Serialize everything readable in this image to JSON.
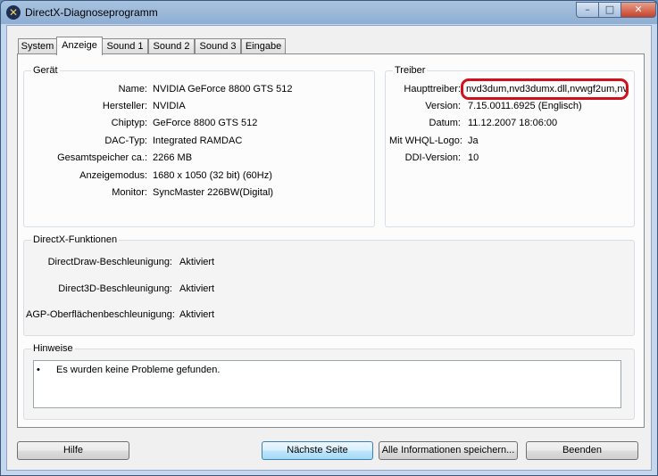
{
  "window": {
    "title": "DirectX-Diagnoseprogramm",
    "icon": "directx-icon"
  },
  "tabs": [
    {
      "label": "System",
      "active": false
    },
    {
      "label": "Anzeige",
      "active": true
    },
    {
      "label": "Sound 1",
      "active": false
    },
    {
      "label": "Sound 2",
      "active": false
    },
    {
      "label": "Sound 3",
      "active": false
    },
    {
      "label": "Eingabe",
      "active": false
    }
  ],
  "device": {
    "title": "Gerät",
    "rows": [
      {
        "label": "Name:",
        "value": "NVIDIA GeForce 8800 GTS 512"
      },
      {
        "label": "Hersteller:",
        "value": "NVIDIA"
      },
      {
        "label": "Chiptyp:",
        "value": "GeForce 8800 GTS 512"
      },
      {
        "label": "DAC-Typ:",
        "value": "Integrated RAMDAC"
      },
      {
        "label": "Gesamtspeicher ca.:",
        "value": "2266 MB"
      },
      {
        "label": "Anzeigemodus:",
        "value": "1680 x 1050 (32 bit) (60Hz)"
      },
      {
        "label": "Monitor:",
        "value": "SyncMaster 226BW(Digital)"
      }
    ]
  },
  "driver": {
    "title": "Treiber",
    "rows": [
      {
        "label": "Haupttreiber:",
        "value": "nvd3dum,nvd3dumx.dll,nvwgf2um,nv"
      },
      {
        "label": "Version:",
        "value": "7.15.0011.6925 (Englisch)"
      },
      {
        "label": "Datum:",
        "value": "11.12.2007 18:06:00"
      },
      {
        "label": "Mit WHQL-Logo:",
        "value": "Ja"
      },
      {
        "label": "DDI-Version:",
        "value": "10"
      }
    ]
  },
  "features": {
    "title": "DirectX-Funktionen",
    "rows": [
      {
        "label": "DirectDraw-Beschleunigung:",
        "value": "Aktiviert"
      },
      {
        "label": "Direct3D-Beschleunigung:",
        "value": "Aktiviert"
      },
      {
        "label": "AGP-Oberflächenbeschleunigung:",
        "value": "Aktiviert"
      }
    ]
  },
  "notes": {
    "title": "Hinweise",
    "bullet": "•",
    "items": [
      "Es wurden keine Probleme gefunden."
    ]
  },
  "buttons": {
    "help": "Hilfe",
    "next": "Nächste Seite",
    "save_all": "Alle Informationen speichern...",
    "exit": "Beenden"
  },
  "colors": {
    "highlight_ring": "#d0101a",
    "close_button": "#c7402a"
  }
}
